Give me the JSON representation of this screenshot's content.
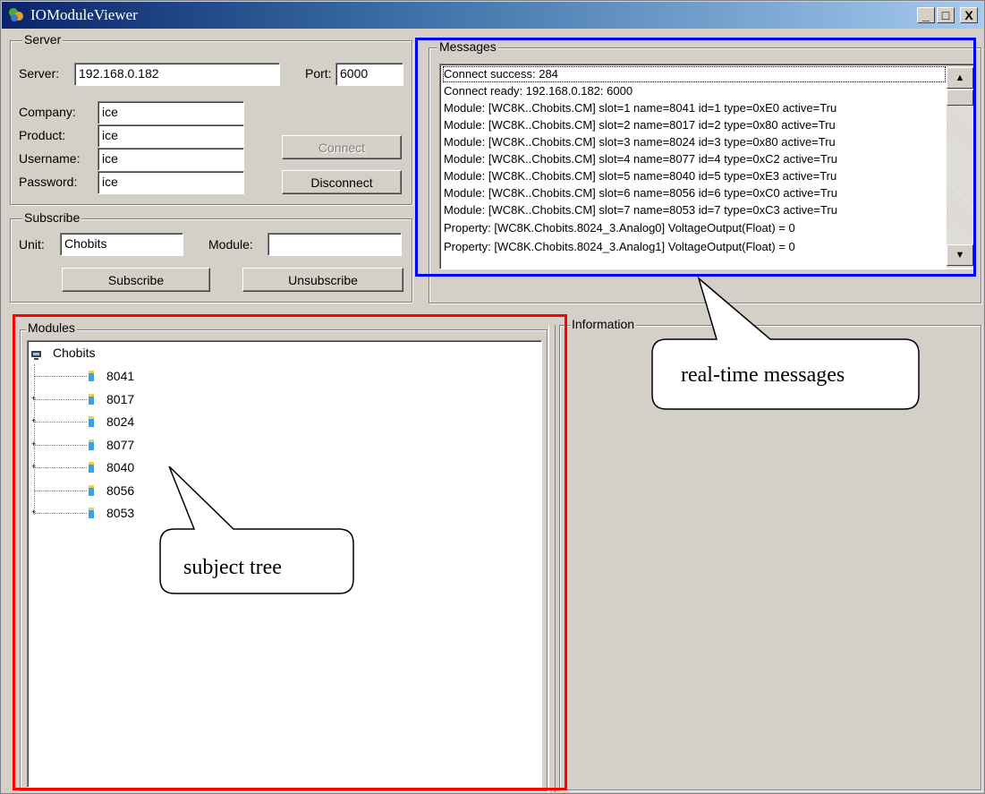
{
  "window": {
    "title": "IOModuleViewer"
  },
  "server": {
    "legend": "Server",
    "server_label": "Server:",
    "server_value": "192.168.0.182",
    "port_label": "Port:",
    "port_value": "6000",
    "company_label": "Company:",
    "company_value": "ice",
    "product_label": "Product:",
    "product_value": "ice",
    "username_label": "Username:",
    "username_value": "ice",
    "password_label": "Password:",
    "password_value": "ice",
    "connect_label": "Connect",
    "disconnect_label": "Disconnect"
  },
  "subscribe": {
    "legend": "Subscribe",
    "unit_label": "Unit:",
    "unit_value": "Chobits",
    "module_label": "Module:",
    "module_value": "",
    "subscribe_label": "Subscribe",
    "unsubscribe_label": "Unsubscribe"
  },
  "messages": {
    "legend": "Messages",
    "lines": [
      "Connect success:  284",
      "Connect ready: 192.168.0.182: 6000",
      "Module: [WC8K..Chobits.CM] slot=1 name=8041 id=1 type=0xE0 active=Tru",
      "Module: [WC8K..Chobits.CM] slot=2 name=8017 id=2 type=0x80 active=Tru",
      "Module: [WC8K..Chobits.CM] slot=3 name=8024 id=3 type=0x80 active=Tru",
      "Module: [WC8K..Chobits.CM] slot=4 name=8077 id=4 type=0xC2 active=Tru",
      "Module: [WC8K..Chobits.CM] slot=5 name=8040 id=5 type=0xE3 active=Tru",
      "Module: [WC8K..Chobits.CM] slot=6 name=8056 id=6 type=0xC0 active=Tru",
      "Module: [WC8K..Chobits.CM] slot=7 name=8053 id=7 type=0xC3 active=Tru",
      "Property: [WC8K.Chobits.8024_3.Analog0] VoltageOutput(Float) =  0",
      "Property: [WC8K.Chobits.8024_3.Analog1] VoltageOutput(Float) =  0"
    ]
  },
  "modules": {
    "legend": "Modules",
    "root": "Chobits",
    "items": [
      {
        "label": "8041",
        "expandable": false
      },
      {
        "label": "8017",
        "expandable": true
      },
      {
        "label": "8024",
        "expandable": true
      },
      {
        "label": "8077",
        "expandable": true
      },
      {
        "label": "8040",
        "expandable": true
      },
      {
        "label": "8056",
        "expandable": false
      },
      {
        "label": "8053",
        "expandable": true
      }
    ]
  },
  "information": {
    "legend": "Information"
  },
  "annotations": {
    "messages_callout": "real-time messages",
    "tree_callout": "subject tree",
    "messages_color": "#0000ff",
    "tree_color": "#ff0000"
  },
  "icons": {
    "app": "app-icon",
    "minimize": "minimize-icon",
    "maximize": "maximize-icon",
    "close": "close-icon",
    "tree_root": "computer-icon",
    "tree_item": "module-icon",
    "expand": "plus-icon",
    "scroll_up": "arrow-up-icon",
    "scroll_down": "arrow-down-icon"
  },
  "window_controls": {
    "minimize": "_",
    "maximize": "□",
    "close": "X"
  }
}
